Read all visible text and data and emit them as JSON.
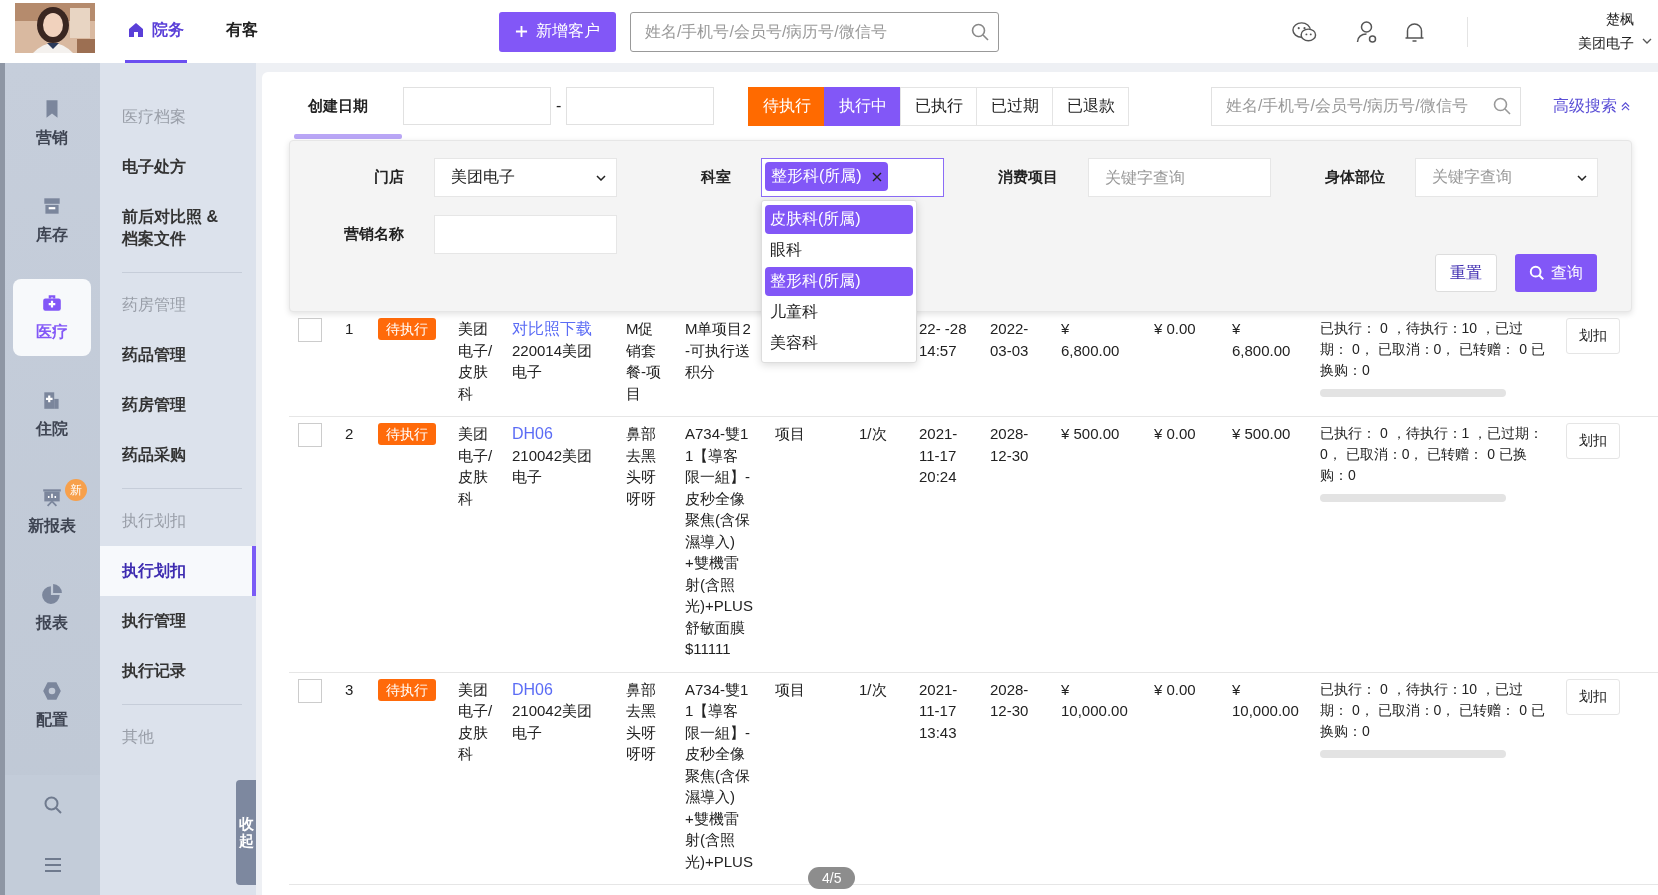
{
  "header": {
    "nav_tabs": [
      {
        "label": "院务",
        "selected": true
      },
      {
        "label": "有客",
        "selected": false
      }
    ],
    "new_button": "新增客户",
    "search": {
      "placeholder": "姓名/手机号/会员号/病历号/微信号"
    },
    "user": {
      "name": "楚枫",
      "org": "美团电子"
    }
  },
  "rail": {
    "items": [
      {
        "label": "营销",
        "selected": false
      },
      {
        "label": "库存",
        "selected": false
      },
      {
        "label": "医疗",
        "selected": true
      },
      {
        "label": "住院",
        "selected": false
      },
      {
        "label": "新报表",
        "selected": false,
        "badge": "新"
      },
      {
        "label": "报表",
        "selected": false
      },
      {
        "label": "配置",
        "selected": false
      }
    ]
  },
  "sidebar": {
    "sections": [
      {
        "title": "医疗档案",
        "items": [
          {
            "label": "电子处方",
            "selected": false
          },
          {
            "label": "前后对比照 & 档案文件",
            "selected": false
          }
        ]
      },
      {
        "title": "药房管理",
        "items": [
          {
            "label": "药品管理",
            "selected": false
          },
          {
            "label": "药房管理",
            "selected": false
          },
          {
            "label": "药品采购",
            "selected": false
          }
        ]
      },
      {
        "title": "执行划扣",
        "items": [
          {
            "label": "执行划扣",
            "selected": true
          },
          {
            "label": "执行管理",
            "selected": false
          },
          {
            "label": "执行记录",
            "selected": false
          }
        ]
      },
      {
        "title": "其他"
      }
    ],
    "collapse": "收起"
  },
  "filters": {
    "date_label": "创建日期",
    "date_separator": "-",
    "status_tabs": [
      {
        "label": "待执行",
        "selected": true,
        "color": "#ff6a00"
      },
      {
        "label": "执行中",
        "selected": true,
        "color": "#8257f7"
      },
      {
        "label": "已执行",
        "selected": false
      },
      {
        "label": "已过期",
        "selected": false
      },
      {
        "label": "已退款",
        "selected": false
      }
    ],
    "search": {
      "placeholder": "姓名/手机号/会员号/病历号/微信号"
    },
    "advanced_link": "高级搜索"
  },
  "advanced_panel": {
    "fields": [
      {
        "kind": "select",
        "label": "门店",
        "value": "美团电子"
      },
      {
        "kind": "multiselect",
        "label": "科室",
        "tags": [
          "整形科(所属)"
        ],
        "options": [
          {
            "label": "皮肤科(所属)",
            "selected": true
          },
          {
            "label": "眼科",
            "selected": false
          },
          {
            "label": "整形科(所属)",
            "selected": true
          },
          {
            "label": "儿童科",
            "selected": false
          },
          {
            "label": "美容科",
            "selected": false
          }
        ]
      },
      {
        "kind": "input",
        "label": "消费项目",
        "placeholder": "关键字查询"
      },
      {
        "kind": "select",
        "label": "身体部位",
        "placeholder": "关键字查询"
      },
      {
        "kind": "input",
        "label": "营销名称"
      }
    ],
    "buttons": [
      {
        "kind": "secondary",
        "label": "重置"
      },
      {
        "kind": "primary",
        "label": "查询"
      }
    ]
  },
  "table": {
    "rows": [
      {
        "checked": false,
        "index": "1",
        "status": "待执行",
        "store": "美团电子/皮肤科",
        "code_link": "对比照下载",
        "code": "220014美团电子",
        "promo": "M促销套餐-项目",
        "name": "M单项目2-可执行送积分",
        "created": "22- -28 14:57",
        "expiry": "2022-03-03",
        "price": "¥ 6,800.00",
        "discount": "¥ 0.00",
        "actual": "¥ 6,800.00",
        "stats": "已执行： 0 ，待执行：10 ，已过期： 0， 已取消：0， 已转赠： 0 已换购：0",
        "action": "划扣"
      },
      {
        "checked": false,
        "index": "2",
        "status": "待执行",
        "store": "美团电子/皮肤科",
        "code_link": "DH06",
        "code": "210042美团电子",
        "promo": "鼻部去黑头呀呀呀",
        "name": "A734-雙11【導客限一組】-皮秒全像聚焦(含保濕導入)+雙機雷射(含照光)+PLUS舒敏面膜$11111",
        "type": "项目",
        "count": "1/次",
        "created": "2021-11-17 20:24",
        "expiry": "2028-12-30",
        "price": "¥ 500.00",
        "discount": "¥ 0.00",
        "actual": "¥ 500.00",
        "stats": "已执行： 0 ，待执行：1 ，已过期： 0， 已取消：0， 已转赠： 0 已换购：0",
        "action": "划扣"
      },
      {
        "checked": false,
        "index": "3",
        "status": "待执行",
        "store": "美团电子/皮肤科",
        "code_link": "DH06",
        "code": "210042美团电子",
        "promo": "鼻部去黑头呀呀呀",
        "name": "A734-雙11【導客限一組】-皮秒全像聚焦(含保濕導入)+雙機雷射(含照光)+PLUS",
        "type": "项目",
        "count": "1/次",
        "created": "2021-11-17 13:43",
        "expiry": "2028-12-30",
        "price": "¥ 10,000.00",
        "discount": "¥ 0.00",
        "actual": "¥ 10,000.00",
        "stats": "已执行： 0 ，待执行：10 ，已过期： 0， 已取消：0， 已转赠： 0 已换购：0",
        "action": "划扣"
      }
    ]
  },
  "page_indicator": "4/5"
}
